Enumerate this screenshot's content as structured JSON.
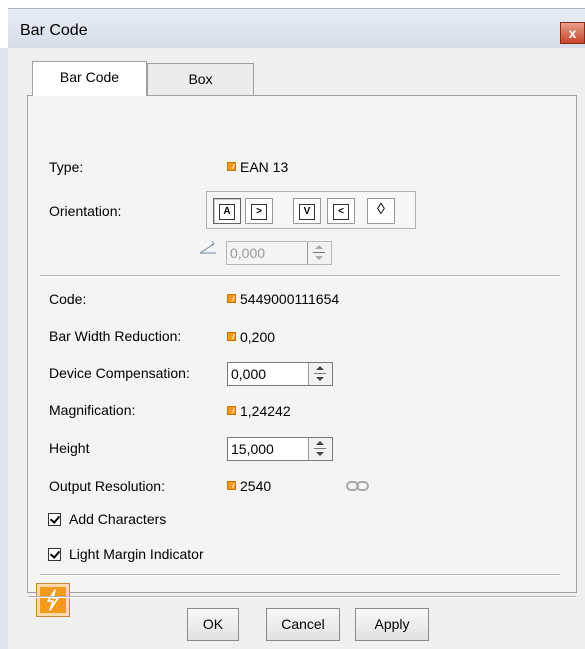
{
  "window": {
    "title": "Bar Code",
    "close_label": "x"
  },
  "tabs": [
    {
      "label": "Bar Code"
    },
    {
      "label": "Box"
    }
  ],
  "fields": {
    "type": {
      "label": "Type:",
      "value": "EAN 13"
    },
    "orientation": {
      "label": "Orientation:",
      "buttons": [
        "A",
        ">",
        "V",
        "<",
        "◊"
      ],
      "angle_value": "0,000"
    },
    "code": {
      "label": "Code:",
      "value": "5449000111654"
    },
    "bar_width_reduction": {
      "label": "Bar Width Reduction:",
      "value": "0,200"
    },
    "device_compensation": {
      "label": "Device Compensation:",
      "value": "0,000"
    },
    "magnification": {
      "label": "Magnification:",
      "value": "1,24242"
    },
    "height": {
      "label": "Height",
      "value": "15,000"
    },
    "output_resolution": {
      "label": "Output Resolution:",
      "value": "2540"
    }
  },
  "checkboxes": {
    "add_characters": {
      "label": "Add Characters",
      "checked": true
    },
    "light_margin": {
      "label": "Light Margin Indicator",
      "checked": true
    }
  },
  "buttons": {
    "ok": "OK",
    "cancel": "Cancel",
    "apply": "Apply"
  },
  "colors": {
    "accent": "#f29a1e",
    "title_bar": "#dde5f0",
    "close": "#c4442a"
  },
  "icons": {
    "field_marker": "lightning-small-icon",
    "bolt": "lightning-icon",
    "link": "chain-link-icon",
    "angle": "angle-icon"
  }
}
